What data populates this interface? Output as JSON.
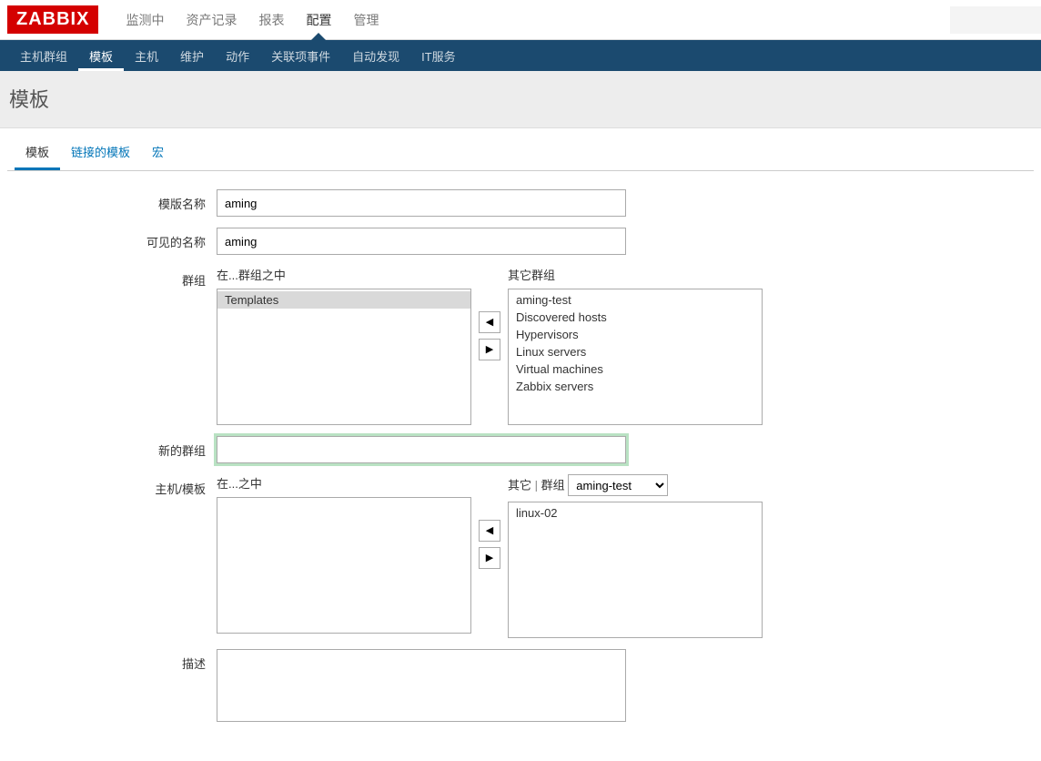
{
  "brand": "ZABBIX",
  "main_menu": {
    "items": [
      {
        "label": "监测中"
      },
      {
        "label": "资产记录"
      },
      {
        "label": "报表"
      },
      {
        "label": "配置",
        "active": true
      },
      {
        "label": "管理"
      }
    ]
  },
  "sub_menu": {
    "items": [
      {
        "label": "主机群组"
      },
      {
        "label": "模板",
        "active": true
      },
      {
        "label": "主机"
      },
      {
        "label": "维护"
      },
      {
        "label": "动作"
      },
      {
        "label": "关联项事件"
      },
      {
        "label": "自动发现"
      },
      {
        "label": "IT服务"
      }
    ]
  },
  "page_title": "模板",
  "tabs": {
    "items": [
      {
        "label": "模板",
        "active": true
      },
      {
        "label": "链接的模板"
      },
      {
        "label": "宏"
      }
    ]
  },
  "form": {
    "template_name": {
      "label": "模版名称",
      "value": "aming"
    },
    "visible_name": {
      "label": "可见的名称",
      "value": "aming"
    },
    "groups": {
      "label": "群组",
      "in_caption": "在...群组之中",
      "other_caption": "其它群组",
      "in_list": [
        {
          "label": "Templates",
          "selected": true
        }
      ],
      "other_list": [
        {
          "label": "aming-test"
        },
        {
          "label": "Discovered hosts"
        },
        {
          "label": "Hypervisors"
        },
        {
          "label": "Linux servers"
        },
        {
          "label": "Virtual machines"
        },
        {
          "label": "Zabbix servers"
        }
      ]
    },
    "new_group": {
      "label": "新的群组",
      "value": ""
    },
    "hosts": {
      "label": "主机/模板",
      "in_caption": "在...之中",
      "other_caption_left": "其它",
      "other_caption_right": "群组",
      "group_select_value": "aming-test",
      "in_list": [],
      "other_list": [
        {
          "label": "linux-02"
        }
      ]
    },
    "description": {
      "label": "描述",
      "value": ""
    }
  },
  "icons": {
    "arrow_left": "◀",
    "arrow_right": "▶"
  }
}
